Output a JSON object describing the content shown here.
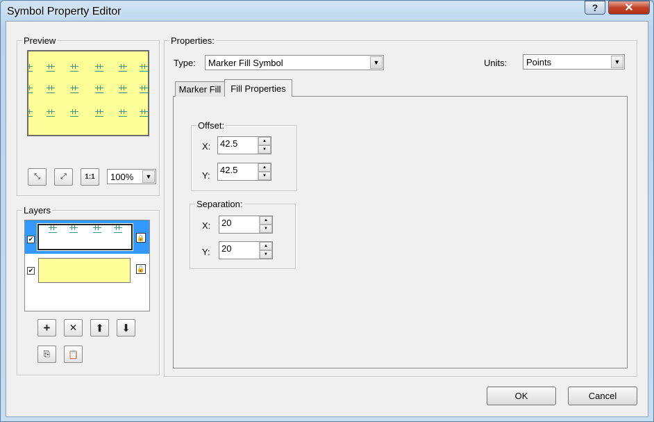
{
  "window": {
    "title": "Symbol Property Editor",
    "help_label": "?",
    "close_label": "✕"
  },
  "preview": {
    "label": "Preview",
    "zoom": {
      "value": "100%"
    },
    "buttons": {
      "shrink": "⤡",
      "fit": "⤢",
      "actual": "1:1"
    }
  },
  "layers": {
    "label": "Layers",
    "items": [
      {
        "name": "marker-fill-layer",
        "checked": true,
        "selected": true
      },
      {
        "name": "simple-fill-layer",
        "checked": true,
        "selected": false
      }
    ],
    "buttons": {
      "add": "+",
      "remove": "✕",
      "up": "⬆",
      "down": "⬇"
    }
  },
  "properties": {
    "label": "Properties:",
    "type_label": "Type:",
    "type_value": "Marker Fill Symbol",
    "units_label": "Units:",
    "units_value": "Points",
    "tabs": [
      {
        "label": "Marker Fill"
      },
      {
        "label": "Fill Properties"
      }
    ],
    "offset": {
      "label": "Offset:",
      "x_label": "X:",
      "x": "42.5",
      "y_label": "Y:",
      "y": "42.5"
    },
    "separation": {
      "label": "Separation:",
      "x_label": "X:",
      "x": "20",
      "y_label": "Y:",
      "y": "20"
    }
  },
  "buttons": {
    "ok": "OK",
    "cancel": "Cancel"
  },
  "colors": {
    "fill": "#ffff99",
    "marker": "#3a9a7a",
    "selection": "#3399ff"
  },
  "icons": [
    "shrink-icon",
    "fit-icon",
    "actual-size-icon",
    "lock-icon",
    "add-icon",
    "delete-icon",
    "arrow-up-icon",
    "arrow-down-icon",
    "copy-icon",
    "paste-icon"
  ]
}
